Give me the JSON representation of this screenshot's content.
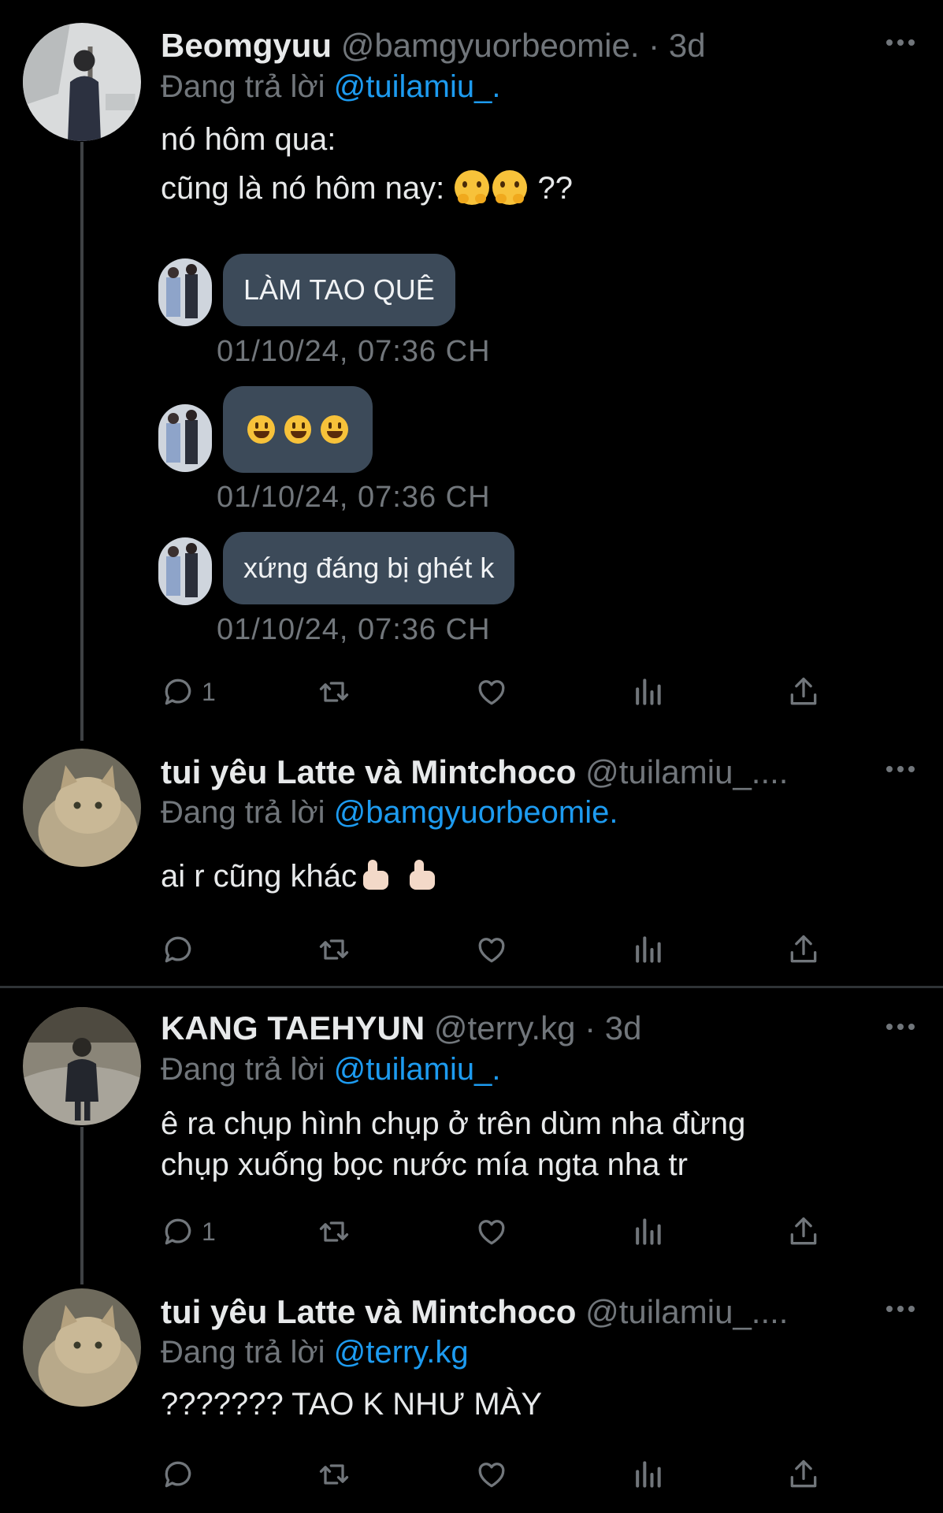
{
  "posts": [
    {
      "name": "Beomgyuu",
      "handle_meta": "@bamgyuorbeomie. · 3d",
      "replying_prefix": "Đang trả lời",
      "replying_to": "@tuilamiu_.",
      "text_line1": "nó hôm qua:",
      "text_line2": "cũng là nó hôm nay:",
      "text_line2_suffix": "??",
      "dms": [
        {
          "text": "LÀM TAO QUÊ",
          "time": "01/10/24, 07:36 CH"
        },
        {
          "text": "",
          "time": "01/10/24, 07:36 CH"
        },
        {
          "text": "xứng đáng bị ghét k",
          "time": "01/10/24, 07:36 CH"
        }
      ],
      "reply_count": "1"
    },
    {
      "name": "tui yêu Latte và Mintchoco",
      "handle_meta": "@tuilamiu_....",
      "replying_prefix": "Đang trả lời",
      "replying_to": "@bamgyuorbeomie.",
      "text": "ai r cũng khác",
      "reply_count": ""
    },
    {
      "name": "KANG TAEHYUN",
      "handle_meta": "@terry.kg · 3d",
      "replying_prefix": "Đang trả lời",
      "replying_to": "@tuilamiu_.",
      "text_line1": "ê ra chụp hình chụp ở trên dùm nha đừng",
      "text_line2": "chụp xuống bọc nước mía ngta nha tr",
      "reply_count": "1"
    },
    {
      "name": "tui yêu Latte và Mintchoco",
      "handle_meta": "@tuilamiu_....",
      "replying_prefix": "Đang trả lời",
      "replying_to": "@terry.kg",
      "text": "??????? TAO K NHƯ MÀY",
      "reply_count": ""
    }
  ],
  "icons": [
    "reply-icon",
    "retweet-icon",
    "like-icon",
    "views-icon",
    "share-icon",
    "more-icon"
  ],
  "colors": {
    "background": "#000000",
    "mention": "#1d9bf0",
    "muted": "#71767b",
    "bubble": "#3c4a59",
    "thread_line": "#3e4144"
  }
}
